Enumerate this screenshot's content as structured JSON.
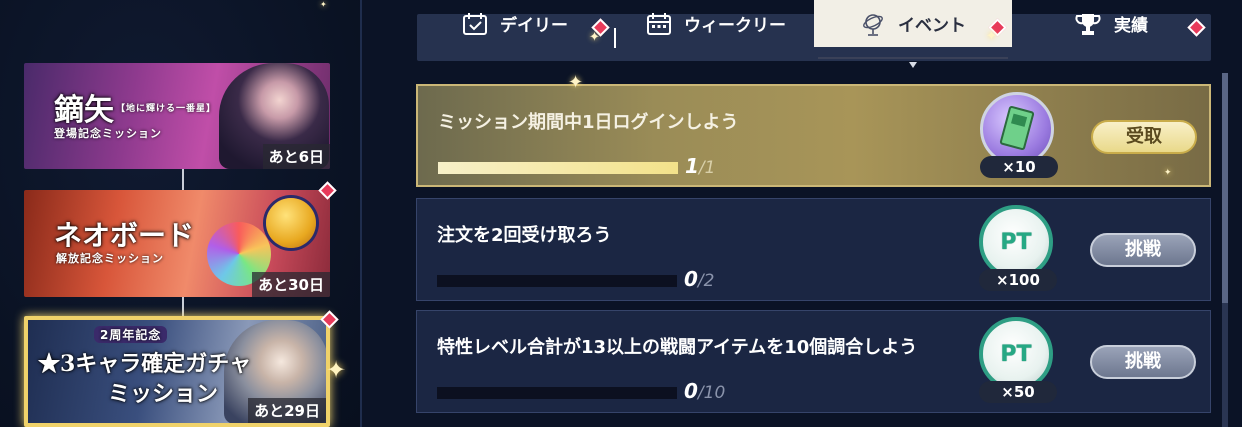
{
  "event_list": [
    {
      "title": "鏑矢",
      "title_tag": "【地に輝ける一番星】",
      "subtitle": "登場記念ミッション",
      "days_left": "あと6日",
      "badge": false
    },
    {
      "title": "ネオボード",
      "subtitle": "解放記念ミッション",
      "days_left": "あと30日",
      "badge": true
    },
    {
      "tag": "2周年記念",
      "title": "★3キャラ確定ガチャ",
      "subtitle": "ミッション",
      "days_left": "あと29日",
      "badge": true,
      "selected": true
    }
  ],
  "tabs": [
    {
      "label": "デイリー",
      "icon": "calendar-check-icon",
      "badge": true,
      "active": false
    },
    {
      "label": "ウィークリー",
      "icon": "calendar-icon",
      "badge": false,
      "active": false
    },
    {
      "label": "イベント",
      "icon": "globe-icon",
      "badge": true,
      "active": true
    },
    {
      "label": "実績",
      "icon": "trophy-icon",
      "badge": true,
      "active": false
    }
  ],
  "missions": [
    {
      "title": "ミッション期間中1日ログインしよう",
      "current": "1",
      "total": "/1",
      "progress": 1.0,
      "reward_icon": "ticket-icon",
      "reward_count": "×10",
      "button": "受取",
      "status": "complete"
    },
    {
      "title": "注文を2回受け取ろう",
      "current": "0",
      "total": "/2",
      "progress": 0.0,
      "reward_icon": "pt-coin-icon",
      "reward_label": "PT",
      "reward_count": "×100",
      "button": "挑戦",
      "status": "incomplete"
    },
    {
      "title": "特性レベル合計が13以上の戦闘アイテムを10個調合しよう",
      "current": "0",
      "total": "/10",
      "progress": 0.0,
      "reward_icon": "pt-coin-icon",
      "reward_label": "PT",
      "reward_count": "×50",
      "button": "挑戦",
      "status": "incomplete"
    }
  ],
  "colors": {
    "badge": "#e83a5a",
    "active_tab": "#f2efe6",
    "complete_gold": "#a89558",
    "pt_green": "#26a884"
  }
}
